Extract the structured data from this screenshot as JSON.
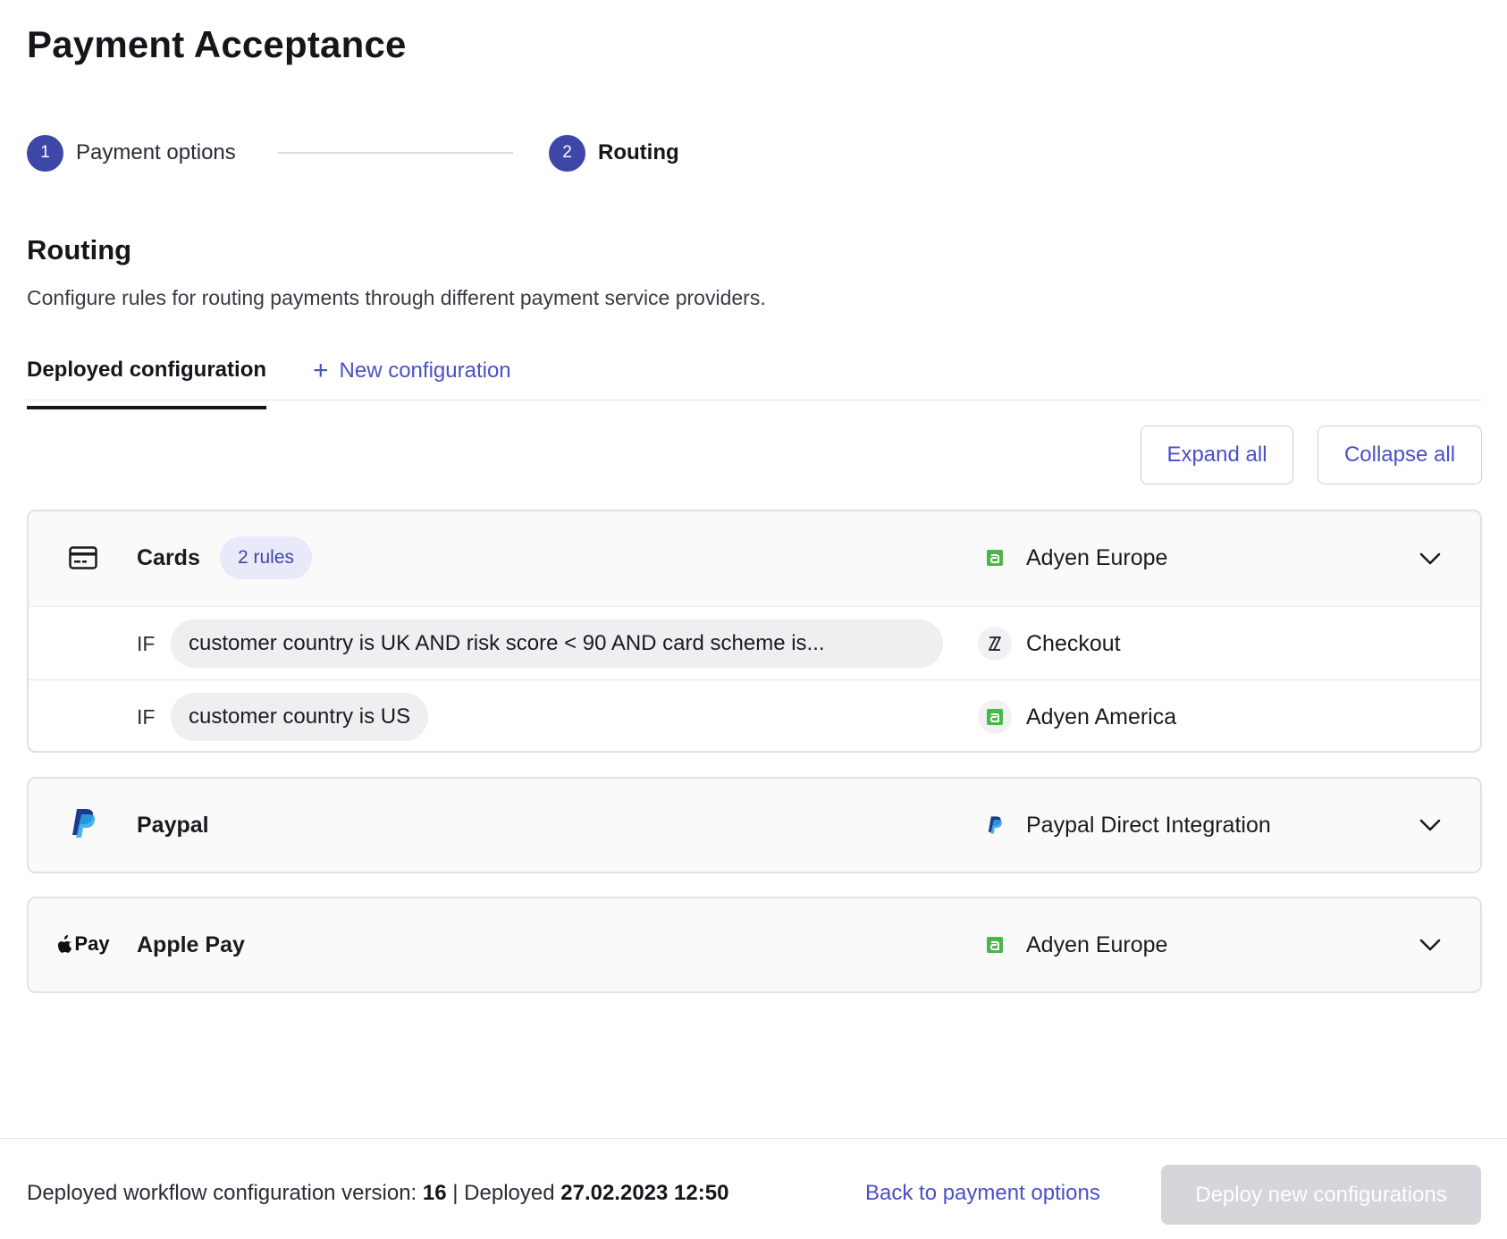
{
  "page": {
    "title": "Payment Acceptance"
  },
  "stepper": {
    "steps": [
      {
        "number": "1",
        "label": "Payment options"
      },
      {
        "number": "2",
        "label": "Routing"
      }
    ]
  },
  "section": {
    "title": "Routing",
    "description": "Configure rules for routing payments through different payment service providers."
  },
  "tabs": {
    "deployed": "Deployed configuration",
    "new": "New configuration",
    "new_icon": "plus-icon"
  },
  "actions": {
    "expand_all": "Expand all",
    "collapse_all": "Collapse all"
  },
  "methods": [
    {
      "name": "Cards",
      "icon": "credit-card-icon",
      "badge": "2 rules",
      "provider": "Adyen Europe",
      "provider_icon": "adyen-logo-icon",
      "rules": [
        {
          "if_label": "IF",
          "condition": "customer country is UK AND risk score < 90 AND card scheme is...",
          "provider": "Checkout",
          "provider_icon": "checkout-logo-icon"
        },
        {
          "if_label": "IF",
          "condition": "customer country is US",
          "provider": "Adyen America",
          "provider_icon": "adyen-logo-icon"
        }
      ]
    },
    {
      "name": "Paypal",
      "icon": "paypal-logo-icon",
      "provider": "Paypal Direct Integration",
      "provider_icon": "paypal-logo-icon"
    },
    {
      "name": "Apple Pay",
      "icon": "apple-pay-logo-icon",
      "icon_text": "Pay",
      "provider": "Adyen Europe",
      "provider_icon": "adyen-logo-icon"
    }
  ],
  "footer": {
    "version_label": "Deployed workflow configuration version:",
    "version": "16",
    "separator": "|",
    "deployed_label": "Deployed",
    "deployed_at": "27.02.2023 12:50",
    "back_link": "Back to payment options",
    "deploy_button": "Deploy new configurations"
  },
  "colors": {
    "accent": "#4a50c7",
    "step_circle": "#3d47a8",
    "adyen_green": "#4bb64b",
    "paypal_dark": "#1f3a8a",
    "paypal_light": "#2aa5e8",
    "disabled_button": "#d5d5da"
  }
}
